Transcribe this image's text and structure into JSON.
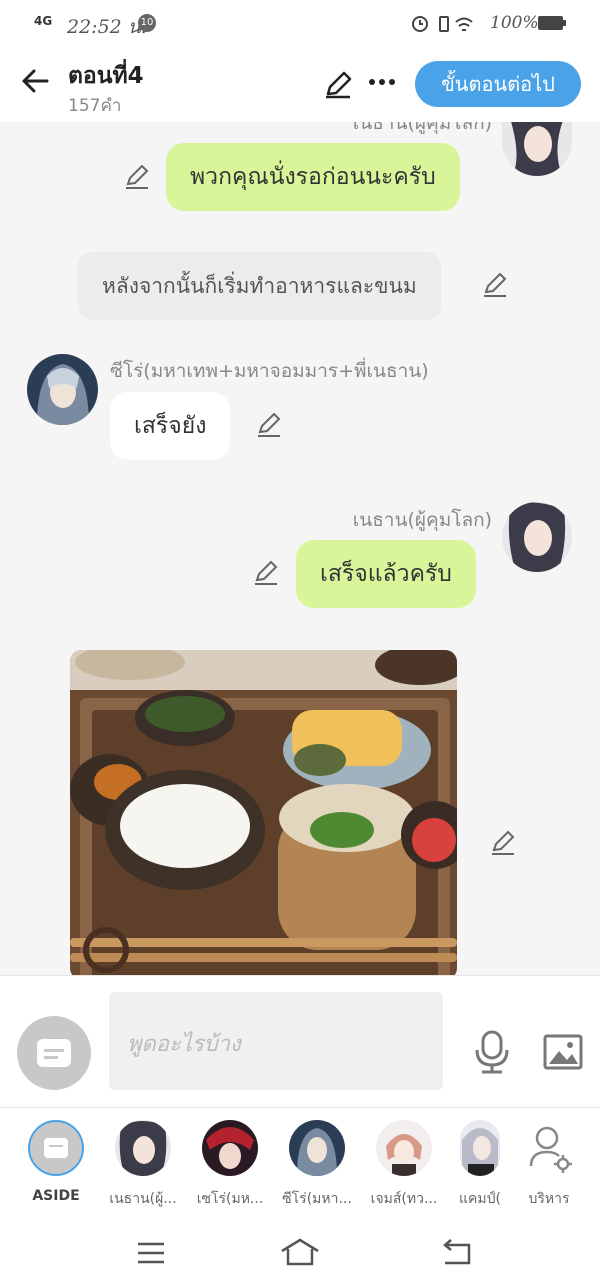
{
  "status_bar": {
    "network": "4G",
    "time": "22:52 น.",
    "notification_count": "10",
    "battery": "100%"
  },
  "header": {
    "title": "ตอนที่4",
    "subtitle": "157คำ",
    "next_button": "ขั้นตอนต่อไป"
  },
  "messages": {
    "m0": {
      "speaker": "เนธาน(ผู้คุมโลก)",
      "text": "พวกคุณนั่งรอก่อนนะครับ"
    },
    "m1": {
      "text": "หลังจากนั้นก็เริ่มทำอาหารและขนม"
    },
    "m2": {
      "speaker": "ซีโร่(มหาเทพ+มหาจอมมาร+พี่เนธาน)",
      "text": "เสร็จยัง"
    },
    "m3": {
      "speaker": "เนธาน(ผู้คุมโลก)",
      "text": "เสร็จแล้วครับ"
    }
  },
  "input": {
    "placeholder": "พูดอะไรบ้าง"
  },
  "characters": [
    {
      "label": "ASIDE"
    },
    {
      "label": "เนธาน(ผู้..."
    },
    {
      "label": "เซโร่(มห..."
    },
    {
      "label": "ซีโร่(มหา..."
    },
    {
      "label": "เจมส์(ทว..."
    },
    {
      "label": "แคมป์("
    },
    {
      "label": "บริหาร"
    }
  ],
  "colors": {
    "accent": "#4aa3e8",
    "my_bubble": "#d8f59a",
    "other_bubble": "#ffffff"
  }
}
